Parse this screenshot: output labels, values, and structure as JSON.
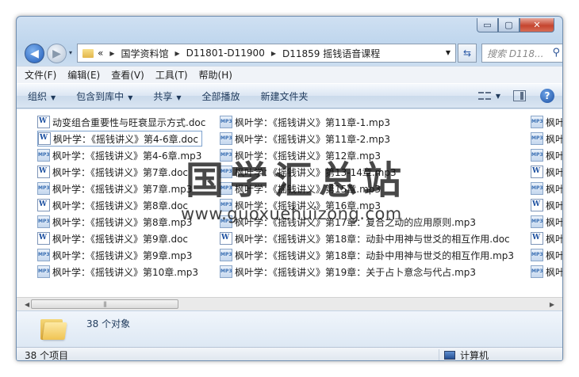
{
  "window": {
    "caption": {
      "minimize": "▭",
      "maximize": "▢",
      "close": "✕"
    }
  },
  "nav": {
    "history_arrow": "▾",
    "breadcrumbs": [
      "«",
      "国学资料馆",
      "D11801-D11900",
      "D11859 摇钱语音课程"
    ],
    "search_placeholder": "搜索 D118..."
  },
  "menu": [
    "文件(F)",
    "编辑(E)",
    "查看(V)",
    "工具(T)",
    "帮助(H)"
  ],
  "commands": {
    "organize": "组织",
    "include_library": "包含到库中",
    "share": "共享",
    "play_all": "全部播放",
    "new_folder": "新建文件夹"
  },
  "files": {
    "column1": [
      {
        "name": "动变组合重要性与旺衰显示方式.doc",
        "type": "doc"
      },
      {
        "name": "枫叶学：《摇钱讲义》第4-6章.doc",
        "type": "doc",
        "selected": true
      },
      {
        "name": "枫叶学：《摇钱讲义》第4-6章.mp3",
        "type": "mp3"
      },
      {
        "name": "枫叶学：《摇钱讲义》第7章.doc",
        "type": "doc"
      },
      {
        "name": "枫叶学：《摇钱讲义》第7章.mp3",
        "type": "mp3"
      },
      {
        "name": "枫叶学：《摇钱讲义》第8章.doc",
        "type": "doc"
      },
      {
        "name": "枫叶学：《摇钱讲义》第8章.mp3",
        "type": "mp3"
      },
      {
        "name": "枫叶学：《摇钱讲义》第9章.doc",
        "type": "doc"
      },
      {
        "name": "枫叶学：《摇钱讲义》第9章.mp3",
        "type": "mp3"
      },
      {
        "name": "枫叶学：《摇钱讲义》第10章.mp3",
        "type": "mp3"
      }
    ],
    "column2": [
      {
        "name": "枫叶学：《摇钱讲义》第11章-1.mp3",
        "type": "mp3"
      },
      {
        "name": "枫叶学：《摇钱讲义》第11章-2.mp3",
        "type": "mp3"
      },
      {
        "name": "枫叶学：《摇钱讲义》第12章.mp3",
        "type": "mp3"
      },
      {
        "name": "枫叶学：《摇钱讲义》第13-14章.mp3",
        "type": "mp3"
      },
      {
        "name": "枫叶学：《摇钱讲义》第15章.mp3",
        "type": "mp3"
      },
      {
        "name": "枫叶学：《摇钱讲义》第16章.mp3",
        "type": "mp3"
      },
      {
        "name": "枫叶学：《摇钱讲义》第17章：复合之动的应用原则.mp3",
        "type": "mp3"
      },
      {
        "name": "枫叶学：《摇钱讲义》第18章：动卦中用神与世爻的相互作用.doc",
        "type": "doc"
      },
      {
        "name": "枫叶学：《摇钱讲义》第18章：动卦中用神与世爻的相互作用.mp3",
        "type": "mp3"
      },
      {
        "name": "枫叶学：《摇钱讲义》第19章：关于占卜意念与代占.mp3",
        "type": "mp3"
      }
    ],
    "column3": [
      {
        "name": "枫叶",
        "type": "mp3"
      },
      {
        "name": "枫叶",
        "type": "mp3"
      },
      {
        "name": "枫叶",
        "type": "mp3"
      },
      {
        "name": "枫叶",
        "type": "doc"
      },
      {
        "name": "枫叶",
        "type": "mp3"
      },
      {
        "name": "枫叶",
        "type": "doc"
      },
      {
        "name": "枫叶",
        "type": "mp3"
      },
      {
        "name": "枫叶",
        "type": "doc"
      },
      {
        "name": "枫叶",
        "type": "mp3"
      },
      {
        "name": "枫叶",
        "type": "mp3"
      }
    ]
  },
  "scrollbar": {
    "left_arrow": "◀",
    "right_arrow": "▶",
    "grip": "|||"
  },
  "details": {
    "count": "38 个对象"
  },
  "status": {
    "items": "38 个项目",
    "zone": "计算机"
  },
  "watermark": {
    "title": "国学汇总站",
    "url": "www.guoxuehuizong.com"
  }
}
